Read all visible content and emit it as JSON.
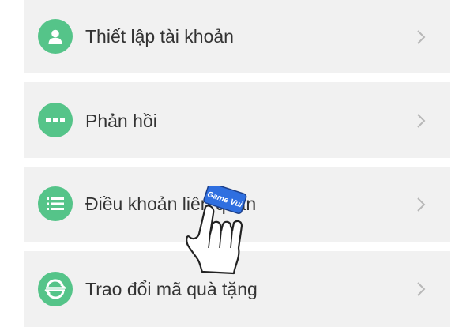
{
  "menu": {
    "items": [
      {
        "label": "Thiết lập tài khoản",
        "icon": "user-icon"
      },
      {
        "label": "Phản hồi",
        "icon": "more-dots-icon"
      },
      {
        "label": "Điều khoản liên quan",
        "icon": "list-icon"
      },
      {
        "label": "Trao đổi mã quà tặng",
        "icon": "exchange-icon"
      }
    ]
  },
  "overlay": {
    "tag_text": "Game Vui",
    "pointer_icon": "hand-pointer-icon"
  },
  "colors": {
    "icon_bg": "#55c489",
    "row_bg": "#f1f1f1",
    "label_text": "#333333",
    "chevron": "#b8b8b8",
    "tag_bg": "#2f6fe0"
  }
}
